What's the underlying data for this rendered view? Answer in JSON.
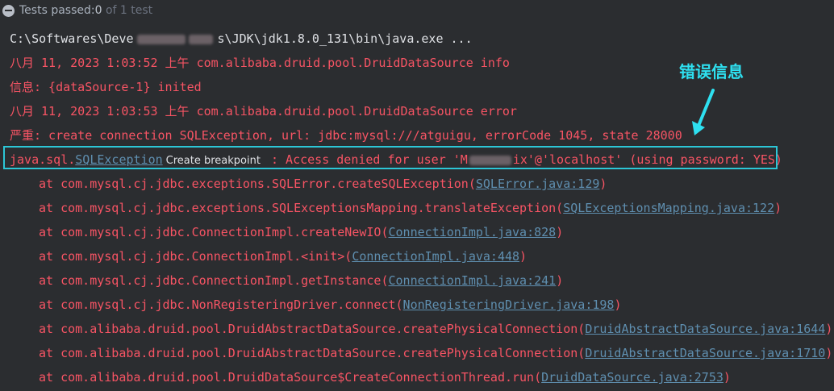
{
  "status": {
    "label": "Tests passed: ",
    "count": "0",
    "total": "of 1 test"
  },
  "console": {
    "cmd_prefix": "C:\\Softwares\\Deve",
    "cmd_suffix": "s\\JDK\\jdk1.8.0_131\\bin\\java.exe ...",
    "line1": "八月 11, 2023 1:03:52 上午 com.alibaba.druid.pool.DruidDataSource info",
    "line2": "信息: {dataSource-1} inited",
    "line3": "八月 11, 2023 1:03:53 上午 com.alibaba.druid.pool.DruidDataSource error",
    "line4": "严重: create connection SQLException, url: jdbc:mysql:///atguigu, errorCode 1045, state 28000",
    "exception": {
      "prefix": "java.sql.",
      "link": "SQLException",
      "tooltip": "Create breakpoint",
      "msg_a": " : Access denied for user 'M",
      "msg_b": "ix'@'localhost' (using password: YES)"
    },
    "traces": [
      {
        "text": "at com.mysql.cj.jdbc.exceptions.SQLError.createSQLException(",
        "link": "SQLError.java:129",
        "close": ")"
      },
      {
        "text": "at com.mysql.cj.jdbc.exceptions.SQLExceptionsMapping.translateException(",
        "link": "SQLExceptionsMapping.java:122",
        "close": ")"
      },
      {
        "text": "at com.mysql.cj.jdbc.ConnectionImpl.createNewIO(",
        "link": "ConnectionImpl.java:828",
        "close": ")"
      },
      {
        "text": "at com.mysql.cj.jdbc.ConnectionImpl.<init>(",
        "link": "ConnectionImpl.java:448",
        "close": ")"
      },
      {
        "text": "at com.mysql.cj.jdbc.ConnectionImpl.getInstance(",
        "link": "ConnectionImpl.java:241",
        "close": ")"
      },
      {
        "text": "at com.mysql.cj.jdbc.NonRegisteringDriver.connect(",
        "link": "NonRegisteringDriver.java:198",
        "close": ")"
      },
      {
        "text": "at com.alibaba.druid.pool.DruidAbstractDataSource.createPhysicalConnection(",
        "link": "DruidAbstractDataSource.java:1644",
        "close": ")"
      },
      {
        "text": "at com.alibaba.druid.pool.DruidAbstractDataSource.createPhysicalConnection(",
        "link": "DruidAbstractDataSource.java:1710",
        "close": ")"
      },
      {
        "text": "at com.alibaba.druid.pool.DruidDataSource$CreateConnectionThread.run(",
        "link": "DruidDataSource.java:2753",
        "close": ")"
      }
    ]
  },
  "annotation": {
    "text": "错误信息",
    "color": "#2ee0f0"
  },
  "colors": {
    "background": "#2b2d30",
    "error": "#f75464",
    "link": "#5f8fb0",
    "highlight": "#2cc6d6"
  }
}
